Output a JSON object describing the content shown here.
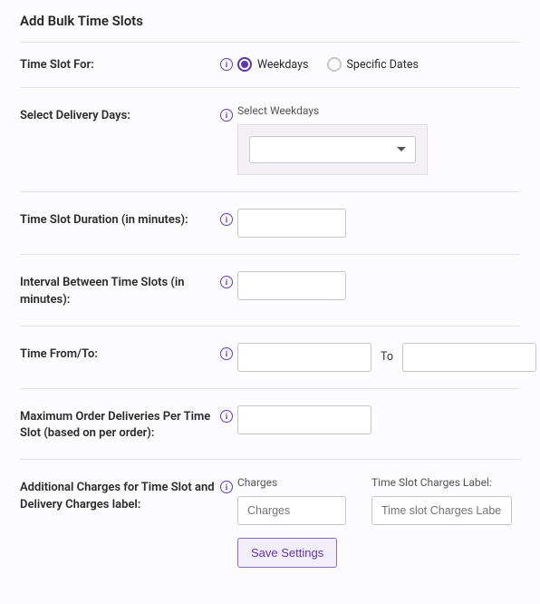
{
  "title": "Add Bulk Time Slots",
  "labels": {
    "time_slot_for": "Time Slot For:",
    "select_delivery_days": "Select Delivery Days:",
    "duration": "Time Slot Duration (in minutes):",
    "interval": "Interval Between Time Slots (in minutes):",
    "time_from_to": "Time From/To:",
    "max_deliveries": "Maximum Order Deliveries Per Time Slot (based on per order):",
    "additional_charges": "Additional Charges for Time Slot and Delivery Charges label:"
  },
  "radios": {
    "weekdays": "Weekdays",
    "specific_dates": "Specific Dates",
    "selected": "weekdays"
  },
  "delivery_days": {
    "caption": "Select Weekdays",
    "value": ""
  },
  "duration_value": "",
  "interval_value": "",
  "time_from": "",
  "time_to": "",
  "to_text": "To",
  "max_deliveries_value": "",
  "charges": {
    "charges_caption": "Charges",
    "charges_placeholder": "Charges",
    "charges_value": "",
    "label_caption": "Time Slot Charges Label:",
    "label_placeholder": "Time slot Charges Label",
    "label_value": ""
  },
  "save_button": "Save Settings",
  "info_glyph": "i"
}
